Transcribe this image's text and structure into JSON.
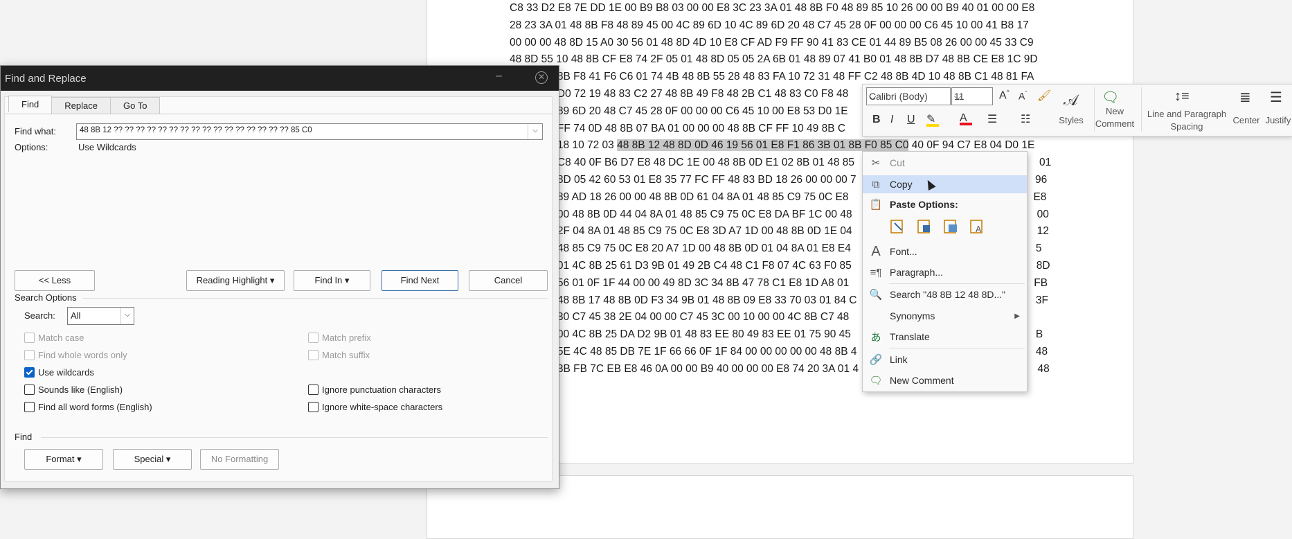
{
  "document": {
    "hex_lines": [
      "C8 33 D2 E8 7E DD 1E 00 B9 B8 03 00 00 E8 3C 23 3A 01 48 8B F0 48 89 85 10 26 00 00 B9 40 01 00 00 E8",
      "28 23 3A 01 48 8B F8 48 89 45 00 4C 89 6D 10 4C 89 6D 20 48 C7 45 28 0F 00 00 00 C6 45 10 00 41 B8 17",
      "00 00 00 48 8D 15 A0 30 56 01 48 8D 4D 10 E8 CF AD F9 FF 90 41 83 CE 01 44 89 B5 08 26 00 00 45 33 C9",
      "48 8D 55 10 48 8B CF E8 74 2F 05 01 48 8D 05 05 2A 6B 01 48 89 07 41 B0 01 48 8B D7 48 8B CE E8 1C 9D",
      "                8B F8 41 F6 C6 01 74 4B 48 8B 55 28 48 83 FA 10 72 31 48 FF C2 48 8B 4D 10 48 8B C1 48 81 FA",
      "                D0 72 19 48 83 C2 27 48 8B 49 F8 48 2B C1 48 83 C0 F8 48",
      "                89 6D 20 48 C7 45 28 0F 00 00 00 C6 45 10 00 E8 53 D0 1E",
      "                FF 74 0D 48 8B 07 BA 01 00 00 00 48 8B CF FF 10 49 8B C",
      "                18 10 72 03 ",
      "                C8 40 0F B6 D7 E8 48 DC 1E 00 48 8B 0D E1 02 8B 01 48 85                                                              01",
      "                8D 05 42 60 53 01 E8 35 77 FC FF 48 83 BD 18 26 00 00 00 7                                                            96",
      "                89 AD 18 26 00 00 48 8B 0D 61 04 8A 01 48 85 C9 75 0C E8                                                              E8",
      "                00 48 8B 0D 44 04 8A 01 48 85 C9 75 0C E8 DA BF 1C 00 48                                                              00",
      "                2F 04 8A 01 48 85 C9 75 0C E8 3D A7 1D 00 48 8B 0D 1E 04                                                              12",
      "                48 85 C9 75 0C E8 20 A7 1D 00 48 8B 0D 01 04 8A 01 E8 E4                                                              5",
      "                01 4C 8B 25 61 D3 9B 01 49 2B C4 48 C1 F8 07 4C 63 F0 85                                                              8D",
      "                56 01 0F 1F 44 00 00 49 8D 3C 34 8B 47 78 C1 E8 1D A8 01                                                              FB",
      "                48 8B 17 48 8B 0D F3 34 9B 01 48 8B 09 E8 33 70 03 01 84 C                                                            3F",
      "                30 C7 45 38 2E 04 00 00 C7 45 3C 00 10 00 00 4C 8B C7 48",
      "                00 4C 8B 25 DA D2 9B 01 48 83 EE 80 49 83 EE 01 75 90 45                                                              B",
      "                5E 4C 48 85 DB 7E 1F 66 66 0F 1F 84 00 00 00 00 00 48 8B 4                                                            48",
      "                3B FB 7C EB E8 46 0A 00 00 B9 40 00 00 00 E8 74 20 3A 01 4                                                            48"
    ],
    "highlight_text": "48 8B 12 48 8D 0D 46 19 56 01 E8 F1 86 3B 01 8B F0 85 C0",
    "highlight_tail": " 40 0F 94 C7 E8 04 D0 1E"
  },
  "dialog": {
    "title": "Find and Replace",
    "tabs": [
      "Find",
      "Replace",
      "Go To"
    ],
    "find_what_label": "Find what:",
    "find_what_value": "48 8B 12 ?? ?? ?? ?? ?? ?? ?? ?? ?? ?? ?? ?? ?? ?? ?? ?? 85 C0",
    "options_label": "Options:",
    "options_value": "Use Wildcards",
    "less_button": "<< Less",
    "reading_highlight_button": "Reading Highlight ▾",
    "find_in_button": "Find In ▾",
    "find_next_button": "Find Next",
    "cancel_button": "Cancel",
    "search_options_label": "Search Options",
    "search_label": "Search:",
    "search_value": "All",
    "checkboxes_left": [
      {
        "label": "Match case",
        "checked": false,
        "disabled": true
      },
      {
        "label": "Find whole words only",
        "checked": false,
        "disabled": true
      },
      {
        "label": "Use wildcards",
        "checked": true,
        "disabled": false
      },
      {
        "label": "Sounds like (English)",
        "checked": false,
        "disabled": false
      },
      {
        "label": "Find all word forms (English)",
        "checked": false,
        "disabled": false
      }
    ],
    "checkboxes_right": [
      {
        "label": "Match prefix",
        "checked": false,
        "disabled": true
      },
      {
        "label": "Match suffix",
        "checked": false,
        "disabled": true
      },
      {
        "label": "Ignore punctuation characters",
        "checked": false,
        "disabled": false
      },
      {
        "label": "Ignore white-space characters",
        "checked": false,
        "disabled": false
      }
    ],
    "find_section_label": "Find",
    "format_button": "Format ▾",
    "special_button": "Special ▾",
    "no_formatting_button": "No Formatting"
  },
  "mini_toolbar": {
    "font_name": "Calibri (Body)",
    "font_size": "11",
    "styles_label": "Styles",
    "new_comment_label": "New Comment",
    "line_spacing_label": "Line and Paragraph Spacing",
    "center_label": "Center",
    "justify_label": "Justify",
    "highlight_color": "#ffd800",
    "font_color": "#e81123"
  },
  "context_menu": {
    "cut": "Cut",
    "copy": "Copy",
    "paste_options": "Paste Options:",
    "font": "Font...",
    "paragraph": "Paragraph...",
    "search": "Search \"48 8B 12 48 8D...\"",
    "synonyms": "Synonyms",
    "translate": "Translate",
    "link": "Link",
    "new_comment": "New Comment"
  }
}
